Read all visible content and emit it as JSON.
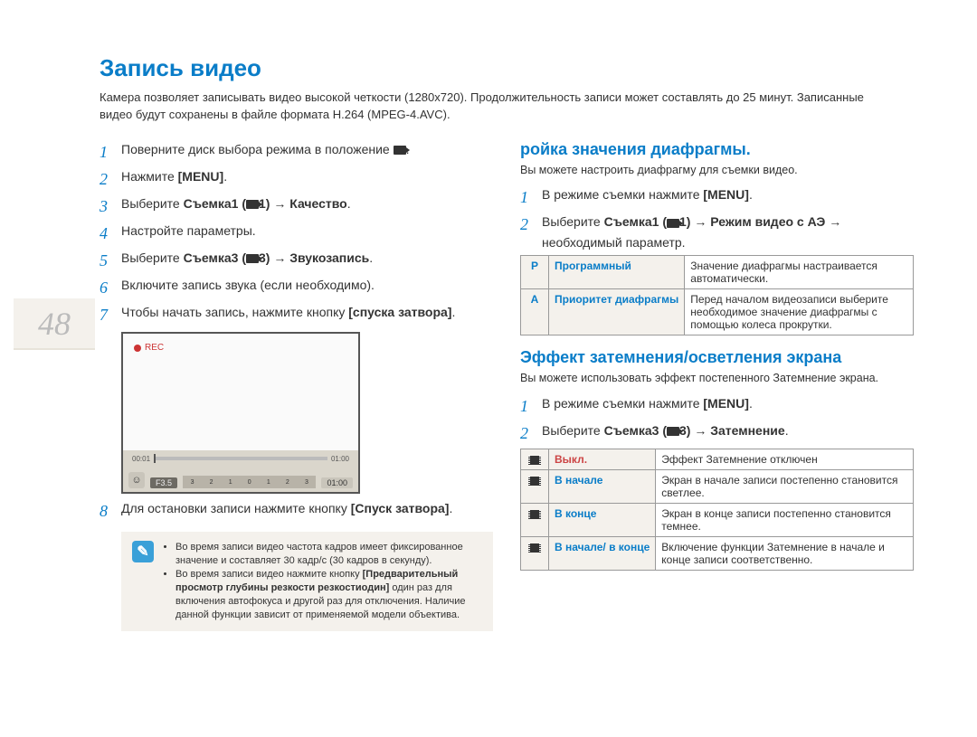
{
  "page_number": "48",
  "title": "Запись видео",
  "intro": "Камера позволяет записывать видео высокой четкости (1280x720). Продолжительность записи может составлять до 25 минут. Записанные видео будут сохранены в файле формата H.264 (MPEG-4.AVC).",
  "left": {
    "steps": [
      {
        "n": "1",
        "pre": "Поверните диск выбора режима в положение ",
        "icon": "cam",
        "post": "."
      },
      {
        "n": "2",
        "pre": "Нажмите ",
        "b": "[MENU]",
        "post": "."
      },
      {
        "n": "3",
        "pre": "Выберите ",
        "b": "Съемка1 (",
        "icon": "cam",
        "b2": "1) → Качество",
        "post": "."
      },
      {
        "n": "4",
        "pre": "Настройте параметры.",
        "b": "",
        "post": ""
      },
      {
        "n": "5",
        "pre": "Выберите ",
        "b": "Съемка3 (",
        "icon": "cam",
        "b2": "3) → Звукозапись",
        "post": "."
      },
      {
        "n": "6",
        "pre": "Включите запись звука (если необходимо).",
        "b": "",
        "post": ""
      },
      {
        "n": "7",
        "pre": "Чтобы начать запись, нажмите кнопку ",
        "b": "[спуска затвора]",
        "post": "."
      }
    ],
    "screenshot": {
      "rec": "REC",
      "time_left": "00:01",
      "time_right": "01:00",
      "f_value": "F3.5",
      "scale": [
        "3",
        "2",
        "1",
        "0",
        "1",
        "2",
        "3"
      ],
      "duration": "01:00"
    },
    "step8": {
      "n": "8",
      "pre": "Для остановки записи нажмите кнопку ",
      "b": "[Спуск затвора]",
      "post": "."
    },
    "note": {
      "bullets": [
        "Во время записи видео частота кадров имеет фиксированное значение и составляет 30 кадр/с (30 кадров в секунду).",
        {
          "pre": "Во время записи видео нажмите кнопку ",
          "b": "[Предварительный просмотр глубины резкости резкостиодин]",
          "post": " один раз для включения автофокуса и другой раз для отключения. Наличие данной функции зависит от применяемой модели объектива."
        }
      ]
    }
  },
  "right": {
    "sec1": {
      "title": "ройка значения диафрагмы.",
      "intro": "Вы можете настроить диафрагму для съемки видео.",
      "steps": [
        {
          "n": "1",
          "pre": "В режиме съемки нажмите ",
          "b": "[MENU]",
          "post": "."
        },
        {
          "n": "2",
          "pre": "Выберите ",
          "b": "Съемка1 (",
          "icon": "cam",
          "b2": "1) → Режим видео с АЭ",
          "post": " → необходимый параметр."
        }
      ],
      "table": [
        {
          "icon": "P",
          "label": "Программный",
          "desc": "Значение диафрагмы настраивается автоматически."
        },
        {
          "icon": "A",
          "label": "Приоритет диафрагмы",
          "desc": "Перед началом видеозаписи выберите необходимое значение диафрагмы с помощью колеса прокрутки."
        }
      ]
    },
    "sec2": {
      "title": "Эффект затемнения/осветления экрана",
      "intro": "Вы можете использовать эффект постепенного Затемнение экрана.",
      "steps": [
        {
          "n": "1",
          "pre": "В режиме съемки нажмите ",
          "b": "[MENU]",
          "post": "."
        },
        {
          "n": "2",
          "pre": "Выберите ",
          "b": "Съемка3 (",
          "icon": "cam",
          "b2": "3) → Затемнение",
          "post": "."
        }
      ],
      "table": [
        {
          "icon": "film-off",
          "label": "Выкл.",
          "red": true,
          "desc": "Эффект Затемнение отключен"
        },
        {
          "icon": "film",
          "label": "В начале",
          "desc": "Экран в начале записи постепенно становится светлее."
        },
        {
          "icon": "film",
          "label": "В конце",
          "desc": "Экран в конце записи постепенно становится темнее."
        },
        {
          "icon": "film",
          "label": "В начале/ в конце",
          "desc": "Включение функции Затемнение в начале и конце записи соответственно."
        }
      ]
    }
  }
}
